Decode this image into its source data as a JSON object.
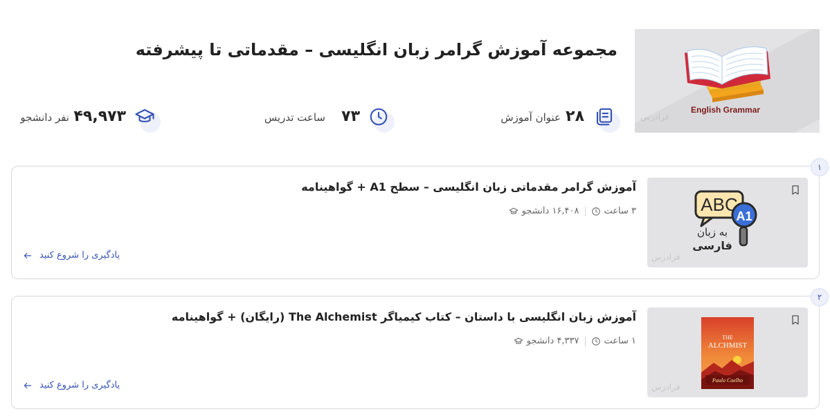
{
  "header": {
    "title": "مجموعه آموزش گرامر زبان انگلیسی – مقدماتی تا پیشرفته",
    "cover_text": "English Grammar",
    "watermark": "فرادرس",
    "stats": [
      {
        "icon": "book-stack-icon",
        "number": "۲۸",
        "label": "عنوان آموزش"
      },
      {
        "icon": "clock-icon",
        "number": "۷۳",
        "label": "ساعت تدریس"
      },
      {
        "icon": "graduation-cap-icon",
        "number": "۴۹,۹۷۳",
        "label": "نفر دانشجو"
      }
    ]
  },
  "courses": [
    {
      "index": "۱",
      "title": "آموزش گرامر مقدماتی زبان انگلیسی – سطح A1 + گواهینامه",
      "students": "۱۶,۴۰۸ دانشجو",
      "hours": "۳ ساعت",
      "start_label": "یادگیری را شروع کنید",
      "thumb_text_1": "ABC",
      "thumb_badge": "A1",
      "thumb_text_2": "به زبان",
      "thumb_text_3": "فارسی",
      "watermark": "فرادرس"
    },
    {
      "index": "۲",
      "title": "آموزش زبان انگلیسی با داستان – کتاب کیمیاگر The Alchemist (رایگان) + گواهینامه",
      "students": "۴,۳۳۷ دانشجو",
      "hours": "۱ ساعت",
      "start_label": "یادگیری را شروع کنید",
      "thumb_text_1": "THE",
      "thumb_text_2": "ALCHMIST",
      "thumb_text_3": "Paulo Coelho",
      "watermark": "فرادرس"
    }
  ],
  "colors": {
    "accent": "#3553b3",
    "icon_bg": "#eef1fb",
    "border": "#d9d9dd",
    "thumb_bg": "#e3e3e5"
  }
}
